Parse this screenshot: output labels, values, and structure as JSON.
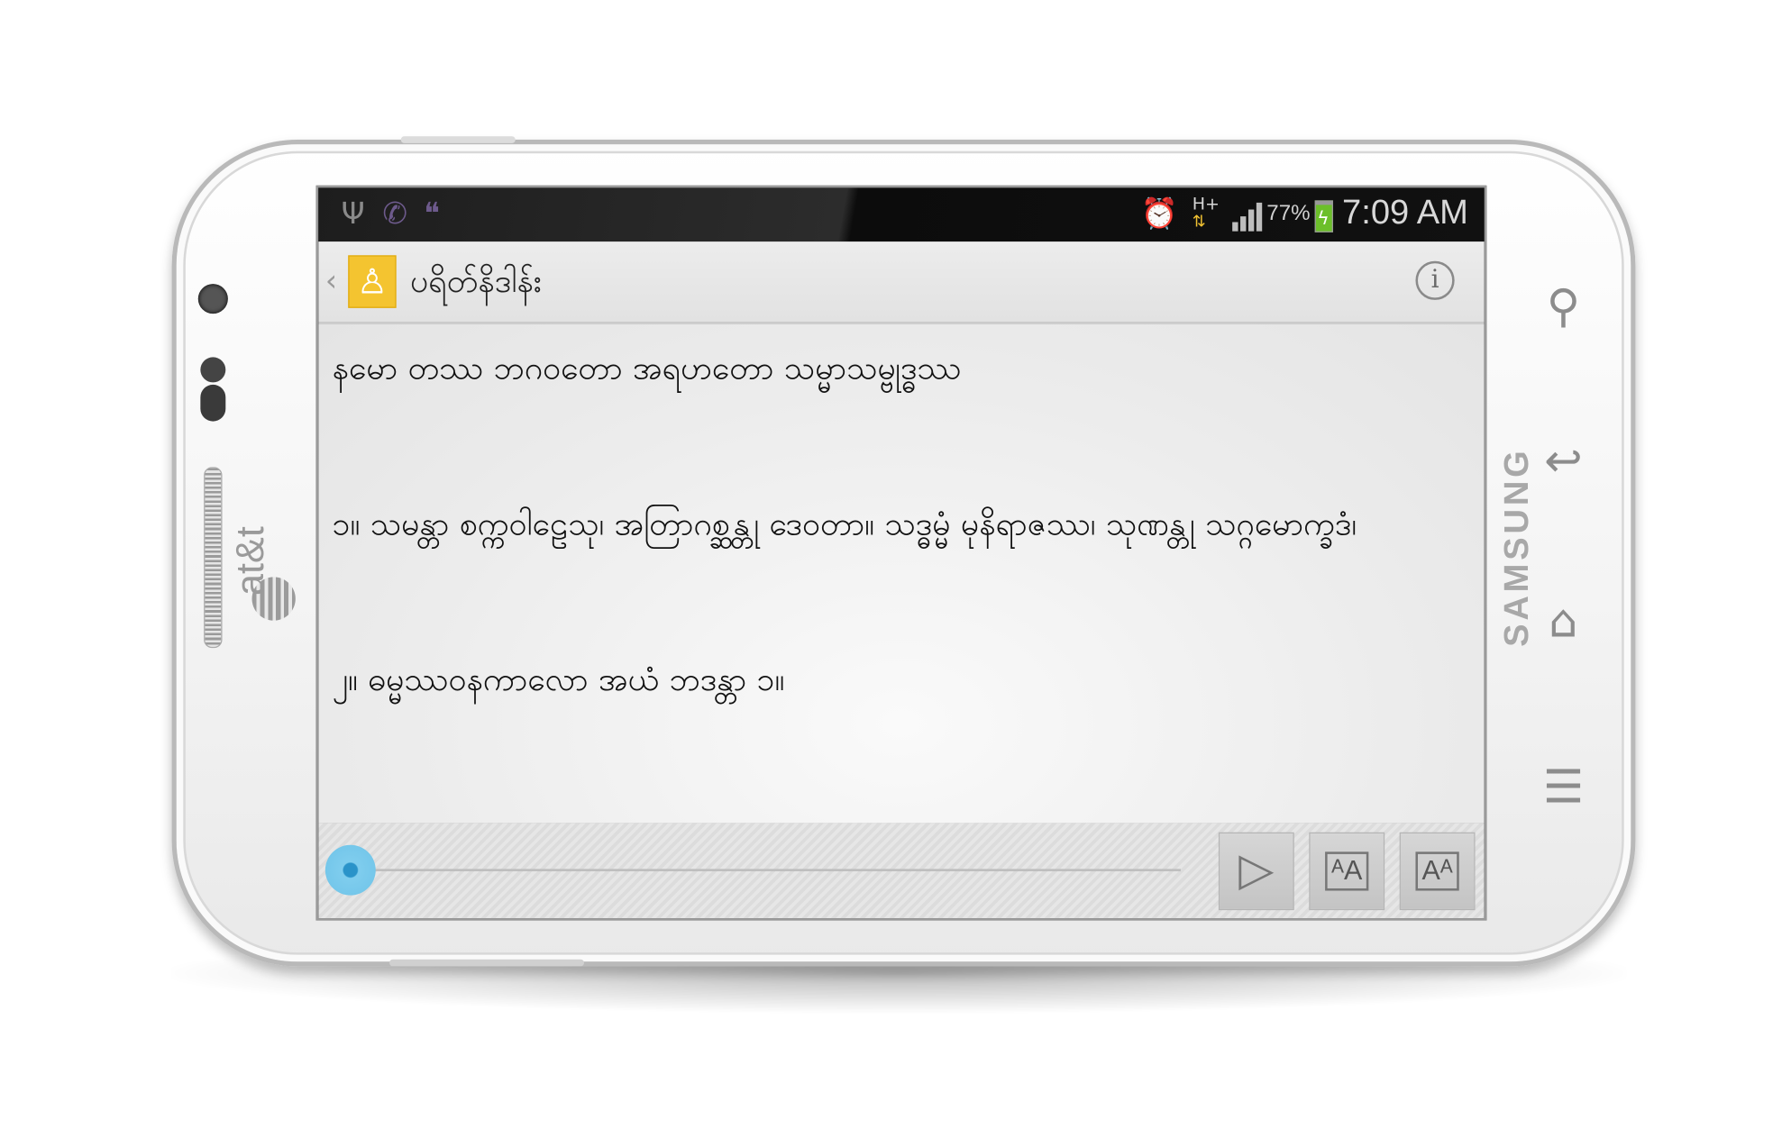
{
  "device": {
    "carrier": "at&t",
    "brand": "SAMSUNG",
    "keys": [
      "search-key",
      "back-key",
      "home-key",
      "menu-key"
    ]
  },
  "status_bar": {
    "network": "H+",
    "battery_percent": "77%",
    "time": "7:09 AM",
    "icons": [
      "usb-icon",
      "call-icon",
      "chat-icon",
      "alarm-icon",
      "signal-icon",
      "battery-icon"
    ]
  },
  "action_bar": {
    "title": "ပရိတ်နိဒါန်း",
    "logo": "buddha-icon",
    "info_icon": "info-icon"
  },
  "content": {
    "verses": [
      "နမော တဿ ဘဂဝတော အရဟတော သမ္မာသမ္ဗုဒ္ဓဿ",
      "၁။ သမန္တာ စက္ကဝါဠေသု၊ အတြာဂစ္ဆန္တု ဒေဝတာ။ သဒ္ဓမ္မံ မုနိရာဇဿ၊ သုဏန္တု သဂ္ဂမောက္ခဒံ၊",
      "၂။ ဓမ္မဿဝနကာလော အယံ ဘဒန္တာ ၁။"
    ]
  },
  "player": {
    "progress": 0,
    "buttons": {
      "play": "▷",
      "text_smaller": "ᴬA",
      "text_larger": "Aᴬ"
    }
  }
}
